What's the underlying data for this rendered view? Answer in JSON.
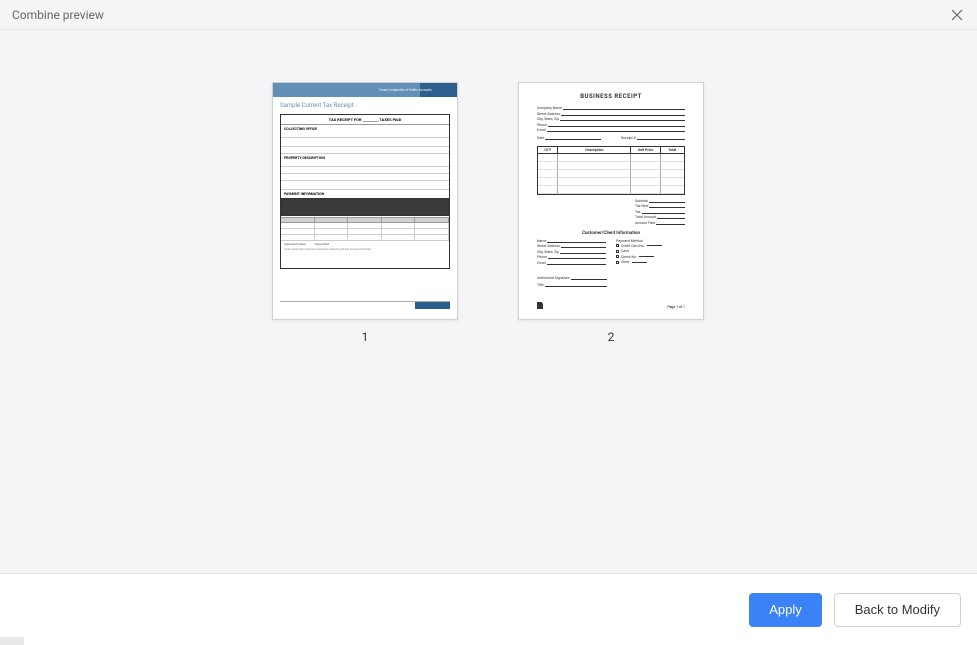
{
  "header": {
    "title": "Combine preview"
  },
  "thumbnails": [
    {
      "label": "1",
      "doc": {
        "header_text": "Texas Comptroller of Public Accounts",
        "title": "Sample Current Tax Receipt",
        "form_head_prefix": "TAX RECEIPT FOR",
        "form_head_suffix": "TAXES PAID",
        "sections": {
          "collector": "COLLECTING OFFICE",
          "property": "PROPERTY DESCRIPTION",
          "payment": "PAYMENT INFORMATION"
        },
        "footer_labels": {
          "assessed": "Appraised Value",
          "taxes": "Taxes Paid"
        }
      }
    },
    {
      "label": "2",
      "doc": {
        "title": "BUSINESS RECEIPT",
        "fields": {
          "company": "Company Name",
          "street": "Street Address",
          "city": "City, State, Zip",
          "phone": "Phone",
          "email": "Email",
          "date": "Date",
          "receipt_no": "Receipt #"
        },
        "table_headers": {
          "qty": "QTY",
          "desc": "Description",
          "unit_price": "Unit Price",
          "total": "Total"
        },
        "totals": {
          "subtotal": "Subtotal",
          "tax_rate": "Tax Rate",
          "tax": "Tax",
          "total_amount": "Total Amount",
          "amount_paid": "Amount Paid"
        },
        "customer_title": "Customer/Client Information",
        "customer_fields": {
          "name": "Name",
          "street": "Street Address",
          "city": "City, State, Zip",
          "phone": "Phone",
          "email": "Email"
        },
        "payment": {
          "label": "Payment Method",
          "credit": "Credit Card No.",
          "cash": "Cash",
          "check": "Check No.",
          "other": "Other"
        },
        "signature": {
          "auth": "Authorized Signature",
          "title": "Title"
        },
        "page_label": "Page 1 of 1"
      }
    }
  ],
  "buttons": {
    "apply": "Apply",
    "back": "Back to Modify"
  }
}
